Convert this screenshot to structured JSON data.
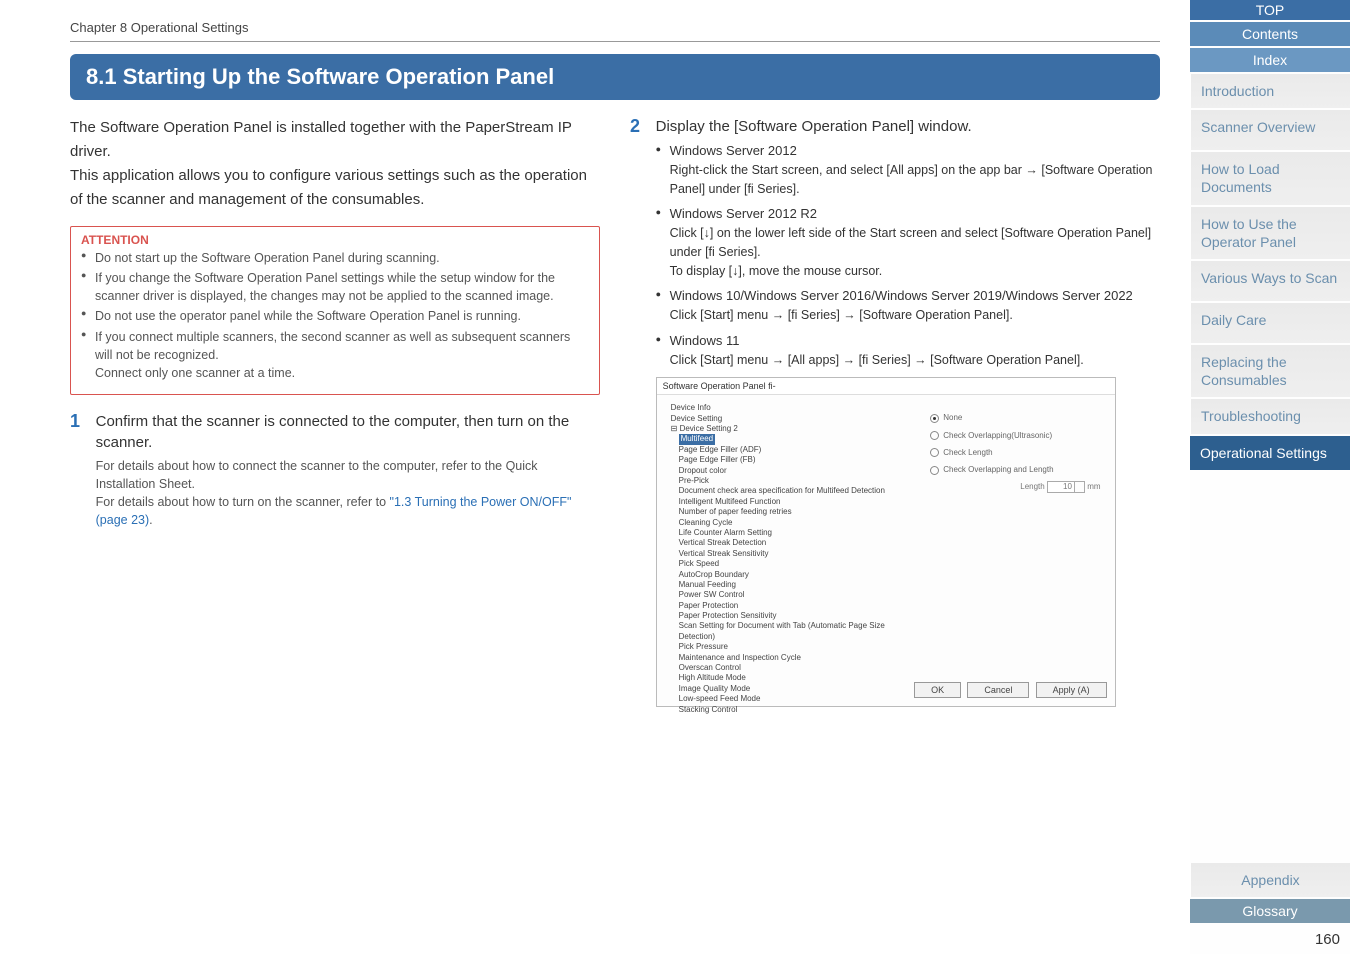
{
  "chapter_header": "Chapter 8 Operational Settings",
  "section_title": "8.1 Starting Up the Software Operation Panel",
  "intro": "The Software Operation Panel is installed together with the PaperStream IP driver.\nThis application allows you to configure various settings such as the operation of the scanner and management of the consumables.",
  "attention_label": "ATTENTION",
  "attention_items": [
    "Do not start up the Software Operation Panel during scanning.",
    "If you change the Software Operation Panel settings while the setup window for the scanner driver is displayed, the changes may not be applied to the scanned image.",
    "Do not use the operator panel while the Software Operation Panel is running.",
    "If you connect multiple scanners, the second scanner as well as subsequent scanners will not be recognized.\nConnect only one scanner at a time."
  ],
  "step1": {
    "num": "1",
    "title": "Confirm that the scanner is connected to the computer, then turn on the scanner.",
    "sub1": "For details about how to connect the scanner to the computer, refer to the Quick Installation Sheet.",
    "sub2_prefix": "For details about how to turn on the scanner, refer to ",
    "sub2_link": "\"1.3 Turning the Power ON/OFF\" (page 23)",
    "sub2_suffix": "."
  },
  "step2": {
    "num": "2",
    "title": "Display the [Software Operation Panel] window.",
    "os_items": [
      {
        "os": "Windows Server 2012",
        "inst": "Right-click the Start screen, and select [All apps] on the app bar → [Software Operation Panel] under [fi Series]."
      },
      {
        "os": "Windows Server 2012 R2",
        "inst": "Click [↓] on the lower left side of the Start screen and select [Software Operation Panel] under [fi Series].\nTo display [↓], move the mouse cursor."
      },
      {
        "os": "Windows 10/Windows Server 2016/Windows Server 2019/Windows Server 2022",
        "inst": "Click [Start] menu → [fi Series] → [Software Operation Panel]."
      },
      {
        "os": "Windows 11",
        "inst": "Click [Start] menu → [All apps] → [fi Series] → [Software Operation Panel]."
      }
    ]
  },
  "screenshot": {
    "title": "Software Operation Panel fi-",
    "tree": [
      "Device Info",
      "Device Setting",
      "Device Setting 2"
    ],
    "tree_sub": [
      "Multifeed",
      "Page Edge Filler (ADF)",
      "Page Edge Filler (FB)",
      "Dropout color",
      "Pre-Pick",
      "Document check area specification for Multifeed Detection",
      "Intelligent Multifeed Function",
      "Number of paper feeding retries",
      "Cleaning Cycle",
      "Life Counter Alarm Setting",
      "Vertical Streak Detection",
      "Vertical Streak Sensitivity",
      "Pick Speed",
      "AutoCrop Boundary",
      "Manual Feeding",
      "Power SW Control",
      "Paper Protection",
      "Paper Protection Sensitivity",
      "Scan Setting for Document with Tab (Automatic Page Size Detection)",
      "Pick Pressure",
      "Maintenance and Inspection Cycle",
      "Overscan Control",
      "High Altitude Mode",
      "Image Quality Mode",
      "Low-speed Feed Mode",
      "Stacking Control"
    ],
    "radios": [
      "None",
      "Check Overlapping(Ultrasonic)",
      "Check Length",
      "Check Overlapping and Length"
    ],
    "length_label": "Length",
    "length_value": "10",
    "length_unit": "mm",
    "buttons": {
      "ok": "OK",
      "cancel": "Cancel",
      "apply": "Apply (A)"
    }
  },
  "sidebar": {
    "top": "TOP",
    "contents": "Contents",
    "index": "Index",
    "introduction": "Introduction",
    "items": [
      "Scanner Overview",
      "How to Load Documents",
      "How to Use the Operator Panel",
      "Various Ways to Scan",
      "Daily Care",
      "Replacing the Consumables",
      "Troubleshooting"
    ],
    "selected": "Operational Settings",
    "appendix": "Appendix",
    "glossary": "Glossary"
  },
  "page_number": "160"
}
